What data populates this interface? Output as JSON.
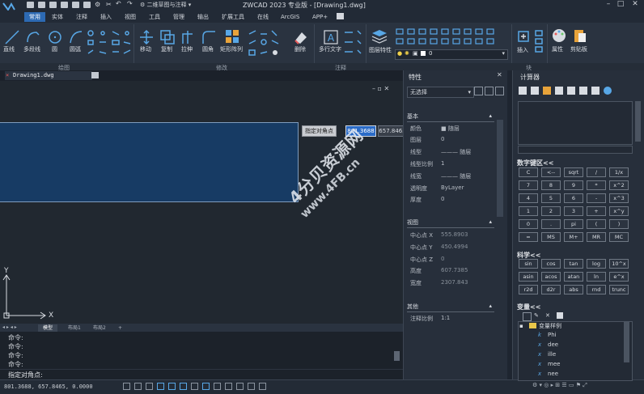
{
  "title_bar": {
    "workspace": "二维草图与注释",
    "document_title": "ZWCAD 2023 专业版 - [Drawing1.dwg]"
  },
  "menu_tabs": [
    "常用",
    "实体",
    "注释",
    "插入",
    "视图",
    "工具",
    "管理",
    "输出",
    "扩展工具",
    "在线",
    "ArcGIS",
    "APP+"
  ],
  "active_tab": "常用",
  "ribbon": {
    "draw_tools": [
      "直线",
      "多段线",
      "圆",
      "圆弧"
    ],
    "modify_tools": [
      "移动",
      "复制",
      "拉伸",
      "圆角",
      "矩形阵列",
      "删除"
    ],
    "annotation_tools": [
      "多行文字"
    ],
    "layer_tools": [
      "图层特性"
    ],
    "layer_current": "0",
    "block_tools": [
      "插入"
    ],
    "properties_tool": "属性",
    "clipboard_tool": "剪贴板",
    "groups": [
      "绘图",
      "修改",
      "注释",
      "块"
    ]
  },
  "document_tab": "Drawing1.dwg",
  "canvas": {
    "prompt_label": "指定对角点",
    "coord_x": "801.3688",
    "coord_y": "657.8465",
    "axis_x": "X",
    "axis_y": "Y"
  },
  "layout_tabs": [
    "模型",
    "布局1",
    "布局2"
  ],
  "command_history": [
    "命令:",
    "命令:",
    "命令:",
    "命令:"
  ],
  "command_prompt": "指定对角点:",
  "status_coords": "801.3688, 657.8465, 0.0000",
  "properties": {
    "title": "特性",
    "selection": "无选择",
    "sections": {
      "basic": "基本",
      "geometry": "视图",
      "other": "其他"
    },
    "basic_rows": [
      {
        "label": "颜色",
        "value": "■ 随层"
      },
      {
        "label": "图层",
        "value": "0"
      },
      {
        "label": "线型",
        "value": "——— 随层"
      },
      {
        "label": "线型比例",
        "value": "1"
      },
      {
        "label": "线宽",
        "value": "——— 随层"
      },
      {
        "label": "透明度",
        "value": "ByLayer"
      },
      {
        "label": "厚度",
        "value": "0"
      }
    ],
    "view_rows": [
      {
        "label": "中心点 X",
        "value": "555.8903"
      },
      {
        "label": "中心点 Y",
        "value": "450.4994"
      },
      {
        "label": "中心点 Z",
        "value": "0"
      },
      {
        "label": "高度",
        "value": "607.7385"
      },
      {
        "label": "宽度",
        "value": "2307.843"
      }
    ],
    "other_rows": [
      {
        "label": "注释比例",
        "value": "1:1"
      }
    ]
  },
  "calculator": {
    "title": "计算器",
    "numpad_title": "数字键区<<",
    "numpad": [
      [
        "C",
        "<--",
        "sqrt",
        "/",
        "1/x"
      ],
      [
        "7",
        "8",
        "9",
        "*",
        "x^2"
      ],
      [
        "4",
        "5",
        "6",
        "-",
        "x^3"
      ],
      [
        "1",
        "2",
        "3",
        "+",
        "x^y"
      ],
      [
        "0",
        ".",
        "pi",
        "(",
        ")"
      ],
      [
        "=",
        "MS",
        "M+",
        "MR",
        "MC"
      ]
    ],
    "sci_title": "科学<<",
    "sci": [
      [
        "sin",
        "cos",
        "tan",
        "log",
        "10^x"
      ],
      [
        "asin",
        "acos",
        "atan",
        "ln",
        "e^x"
      ],
      [
        "r2d",
        "d2r",
        "abs",
        "rnd",
        "trunc"
      ]
    ],
    "var_title": "变量<<",
    "var_folder": "变量样例",
    "variables": [
      {
        "type": "k",
        "name": "Phi"
      },
      {
        "type": "x",
        "name": "dee"
      },
      {
        "type": "x",
        "name": "ille"
      },
      {
        "type": "x",
        "name": "mee"
      },
      {
        "type": "x",
        "name": "nee"
      }
    ]
  },
  "watermark": {
    "line1": "4分贝资源网",
    "line2": "www.4FB.cn"
  },
  "colors": {
    "accent": "#2d6ab3",
    "rect_fill": "#173b64",
    "icon_blue": "#58a7e6"
  }
}
